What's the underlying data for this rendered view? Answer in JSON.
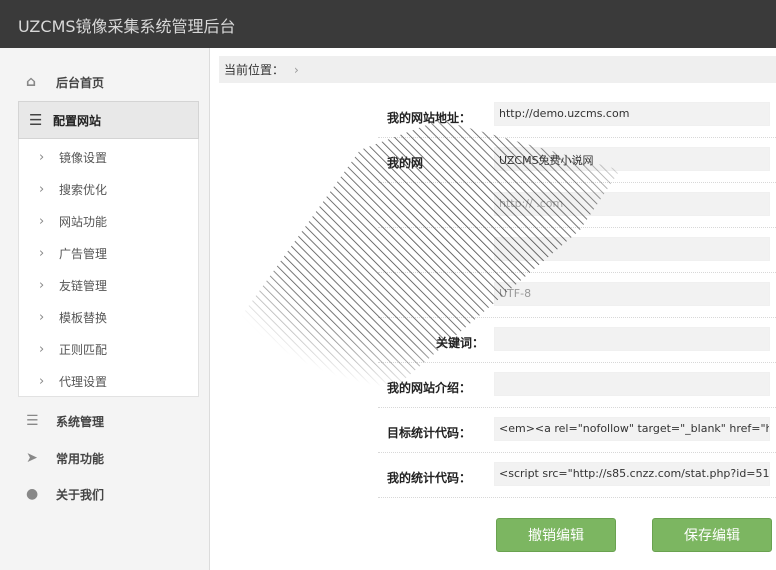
{
  "app": {
    "title": "UZCMS镜像采集系统管理后台"
  },
  "sidebar": {
    "home": "后台首页",
    "config": "配置网站",
    "sub_items": [
      "镜像设置",
      "搜索优化",
      "网站功能",
      "广告管理",
      "友链管理",
      "模板替换",
      "正则匹配",
      "代理设置"
    ],
    "system": "系统管理",
    "common": "常用功能",
    "about": "关于我们"
  },
  "breadcrumb": {
    "label": "当前位置："
  },
  "form": {
    "rows": [
      {
        "label": "我的网站地址：",
        "value": "http://demo.uzcms.com"
      },
      {
        "label": "我的网",
        "value": "UZCMS免费小说网"
      },
      {
        "label": "",
        "value": "http://                  .com"
      },
      {
        "label": "",
        "value": ""
      },
      {
        "label": "",
        "value": "UTF-8"
      },
      {
        "label": "关键词：",
        "value": ""
      },
      {
        "label": "我的网站介绍：",
        "value": ""
      },
      {
        "label": "目标统计代码：",
        "value": "<em><a rel=\"nofollow\" target=\"_blank\" href=\"h"
      },
      {
        "label": "我的统计代码：",
        "value": "<script src=\"http://s85.cnzz.com/stat.php?id=51"
      }
    ]
  },
  "buttons": {
    "cancel": "撤销编辑",
    "save": "保存编辑"
  },
  "colors": {
    "topbar": "#3a3a3a",
    "button": "#7cb661",
    "sidebar": "#f4f4f4"
  }
}
